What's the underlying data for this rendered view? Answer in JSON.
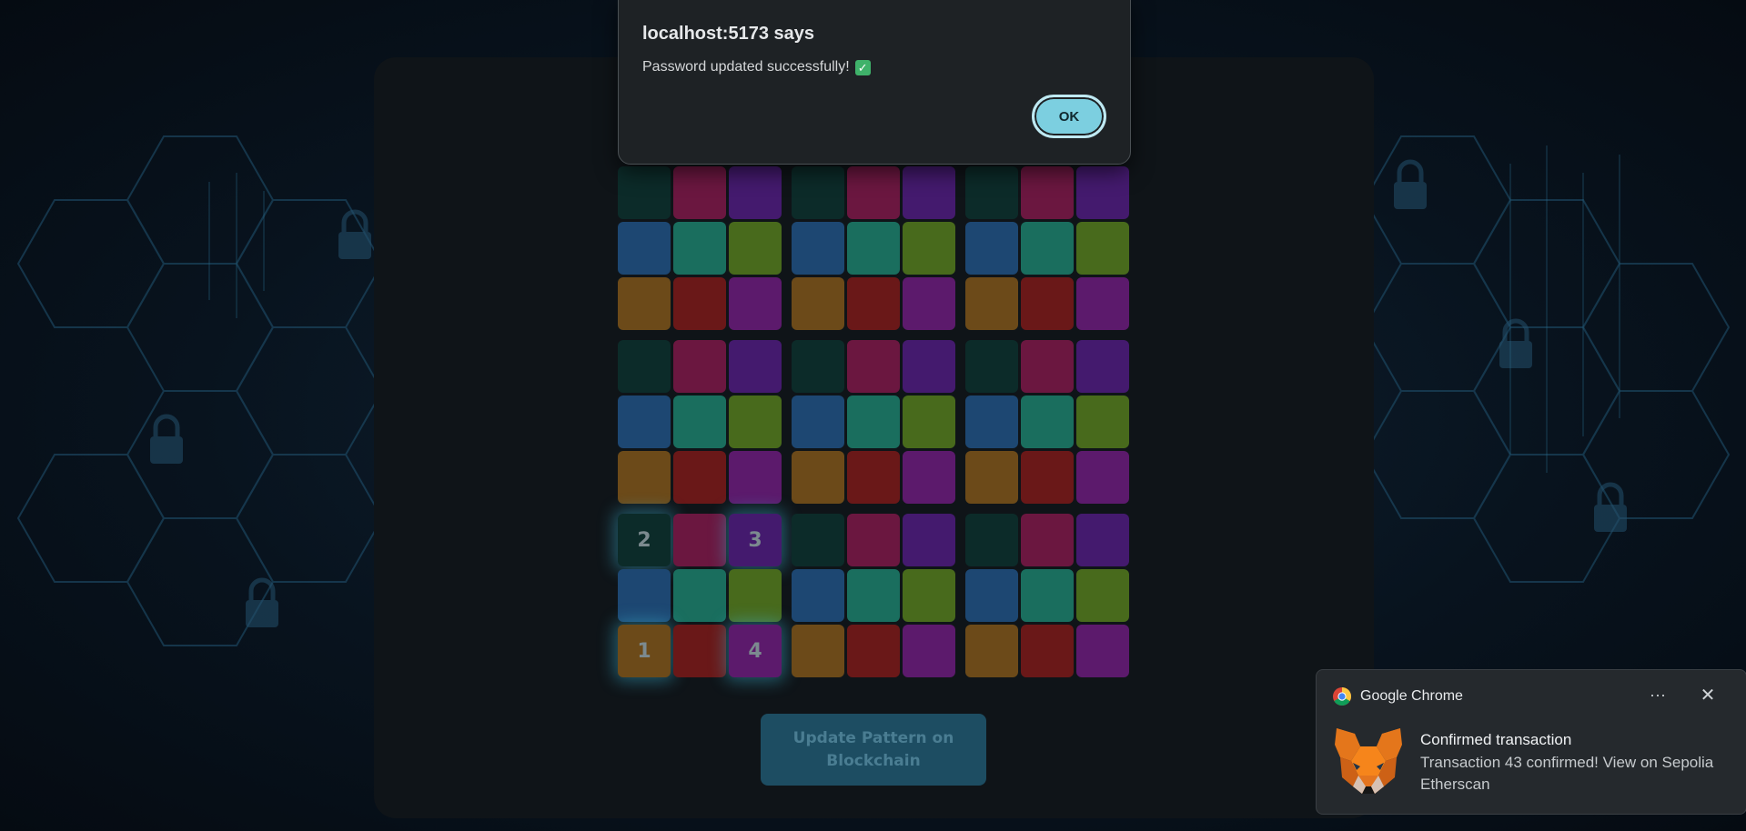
{
  "dialog": {
    "title": "localhost:5173 says",
    "message": "Password updated successfully!",
    "check_icon": "check-mark-icon",
    "ok_label": "OK"
  },
  "pattern_grid": {
    "palette": [
      [
        "#0c2b29",
        "#6b1740",
        "#441a6e"
      ],
      [
        "#1d4772",
        "#1a6e5e",
        "#486a1c"
      ],
      [
        "#6c4a19",
        "#6a1818",
        "#5c1a6c"
      ]
    ],
    "selected": [
      {
        "block_row": 2,
        "block_col": 0,
        "cell_row": 2,
        "cell_col": 0,
        "order": "1"
      },
      {
        "block_row": 2,
        "block_col": 0,
        "cell_row": 0,
        "cell_col": 0,
        "order": "2"
      },
      {
        "block_row": 2,
        "block_col": 0,
        "cell_row": 0,
        "cell_col": 2,
        "order": "3"
      },
      {
        "block_row": 2,
        "block_col": 0,
        "cell_row": 2,
        "cell_col": 2,
        "order": "4"
      }
    ]
  },
  "update_button": {
    "label": "Update Pattern on Blockchain"
  },
  "notification": {
    "app_name": "Google Chrome",
    "app_icon": "chrome-icon",
    "more_icon": "more-options-icon",
    "close_icon": "close-icon",
    "more_label": "···",
    "close_label": "✕",
    "sender_icon": "metamask-fox-icon",
    "title": "Confirmed transaction",
    "body": "Transaction 43 confirmed! View on Sepolia Etherscan"
  }
}
